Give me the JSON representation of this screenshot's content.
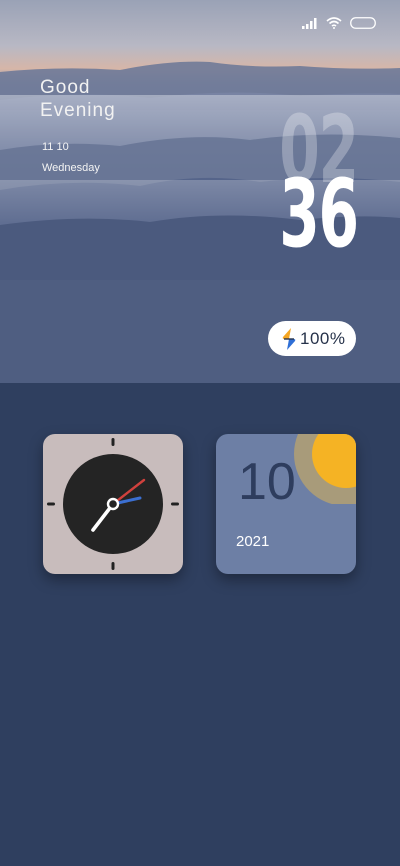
{
  "greeting": {
    "line1": "Good",
    "line2": "Evening"
  },
  "date": {
    "month_day": "11 10",
    "weekday": "Wednesday"
  },
  "time": {
    "hour": "02",
    "minute": "36"
  },
  "battery": {
    "level_label": "100%",
    "level_fraction": 1.0
  },
  "calendar_widget": {
    "day": "10",
    "year": "2021"
  },
  "status_bar": {
    "icons": [
      "signal-icon",
      "wifi-icon",
      "battery-icon"
    ]
  },
  "colors": {
    "background": "#2f3f5f",
    "clock_widget_bg": "#c8bcbc",
    "calendar_widget_bg": "#6d7fa5",
    "sun": "#f5b324",
    "sun_halo": "#a89b7a",
    "hand_red": "#d0413d",
    "hand_blue": "#3b6fd1"
  }
}
